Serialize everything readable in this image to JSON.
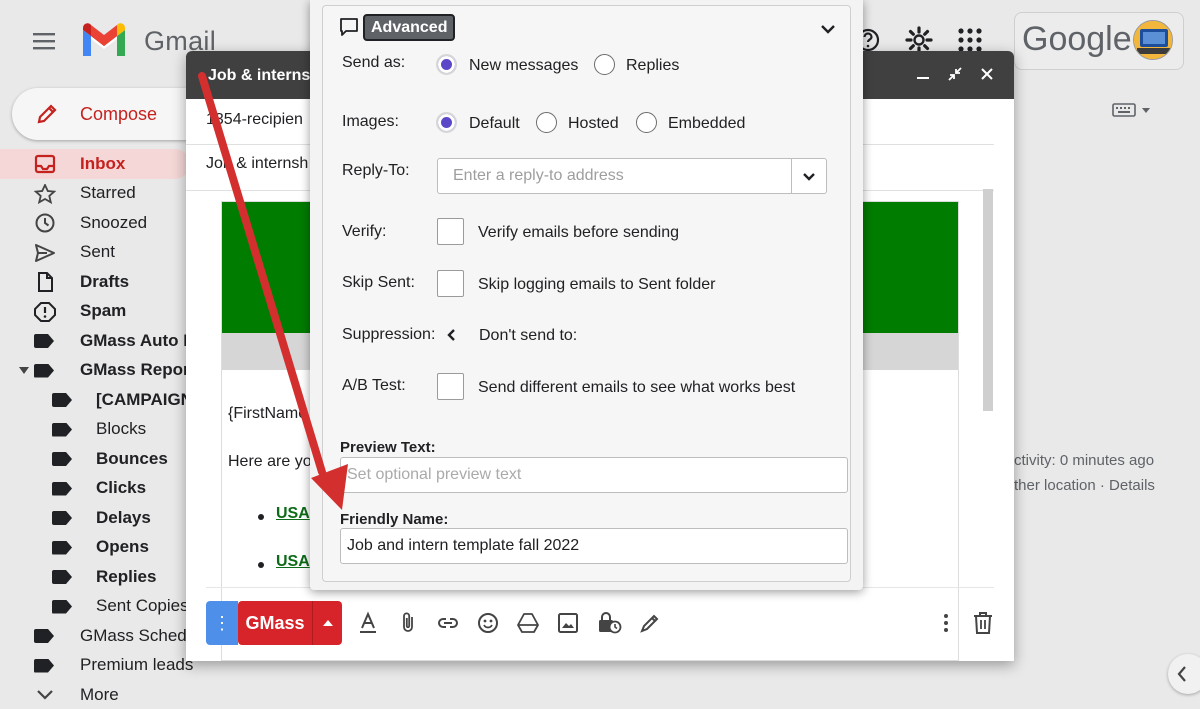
{
  "app": {
    "name": "Gmail",
    "brand_colors": {
      "red": "#c5221f",
      "blue": "#4285f4",
      "green": "#34a853",
      "yellow": "#fbbc04"
    },
    "google_wordmark": "Google"
  },
  "sidebar": {
    "compose_label": "Compose",
    "items": [
      {
        "label": "Inbox",
        "icon": "inbox-icon"
      },
      {
        "label": "Starred",
        "icon": "star-icon"
      },
      {
        "label": "Snoozed",
        "icon": "clock-icon"
      },
      {
        "label": "Sent",
        "icon": "send-icon"
      },
      {
        "label": "Drafts",
        "icon": "draft-icon"
      },
      {
        "label": "Spam",
        "icon": "spam-icon"
      },
      {
        "label": "GMass Auto F",
        "icon": "label-icon"
      },
      {
        "label": "GMass Repor",
        "icon": "label-icon"
      },
      {
        "label": "[CAMPAIGN",
        "icon": "label-icon"
      },
      {
        "label": "Blocks",
        "icon": "label-icon"
      },
      {
        "label": "Bounces",
        "icon": "label-icon"
      },
      {
        "label": "Clicks",
        "icon": "label-icon"
      },
      {
        "label": "Delays",
        "icon": "label-icon"
      },
      {
        "label": "Opens",
        "icon": "label-icon"
      },
      {
        "label": "Replies",
        "icon": "label-icon"
      },
      {
        "label": "Sent Copies",
        "icon": "label-icon"
      },
      {
        "label": "GMass Sched",
        "icon": "label-icon"
      },
      {
        "label": "Premium leads",
        "icon": "label-icon"
      },
      {
        "label": "More",
        "icon": "chevron-down-icon"
      }
    ]
  },
  "right_panel": {
    "activity_line1": "ctivity: 0 minutes ago",
    "activity_line2": "ther location · Details"
  },
  "compose": {
    "title": "Job & interns",
    "recipients": "1354-recipien",
    "subject": "Job & internsh",
    "body": {
      "greeting": "{FirstName",
      "intro": "Here are yo",
      "links": [
        "USA",
        "USA"
      ]
    },
    "toolbar": {
      "send_label": "GMass",
      "options_glyph": "⋮"
    }
  },
  "settings": {
    "section_label": "Advanced",
    "send_as": {
      "label": "Send as:",
      "options": [
        "New messages",
        "Replies"
      ],
      "selected": 0
    },
    "images": {
      "label": "Images:",
      "options": [
        "Default",
        "Hosted",
        "Embedded"
      ],
      "selected": 0
    },
    "reply_to": {
      "label": "Reply-To:",
      "placeholder": "Enter a reply-to address"
    },
    "verify": {
      "label": "Verify:",
      "text": "Verify emails before sending"
    },
    "skip_sent": {
      "label": "Skip Sent:",
      "text": "Skip logging emails to Sent folder"
    },
    "suppression": {
      "label": "Suppression:",
      "text": "Don't send to:"
    },
    "ab_test": {
      "label": "A/B Test:",
      "text": "Send different emails to see what works best"
    },
    "preview_text": {
      "label": "Preview Text:",
      "placeholder": "Set optional preview text"
    },
    "friendly_name": {
      "label": "Friendly Name:",
      "value": "Job and intern template fall 2022"
    }
  },
  "annotation": {
    "arrow_color": "#d32f2f"
  }
}
